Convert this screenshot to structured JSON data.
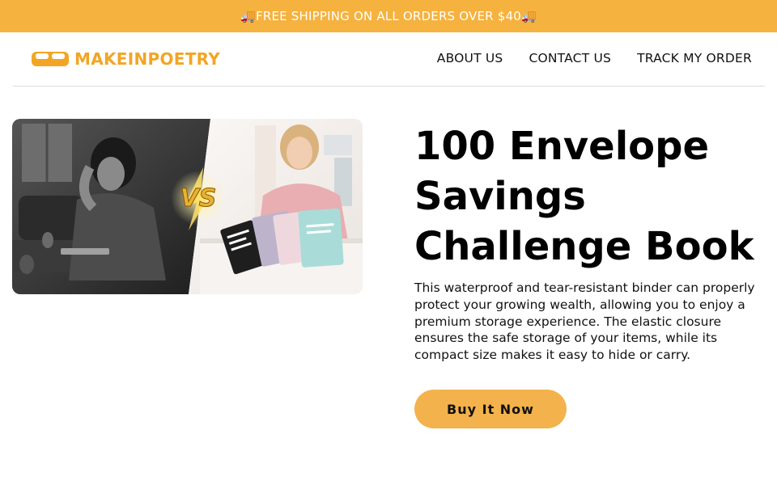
{
  "announcement": {
    "text": "🚚FREE SHIPPING ON ALL ORDERS OVER $40🚚"
  },
  "header": {
    "logo_text": "MAKEINPOETRY",
    "logo_icon": "sofa-icon",
    "nav": [
      {
        "label": "ABOUT US"
      },
      {
        "label": "CONTACT US"
      },
      {
        "label": "TRACK MY ORDER"
      }
    ]
  },
  "hero": {
    "image_badge": "VS",
    "title": "100 Envelope Savings Challenge Book",
    "description": "This waterproof and tear-resistant binder can properly protect your growing wealth, allowing you to enjoy a premium storage experience. The elastic closure ensures the safe storage of your items, while its compact size makes it easy to hide or carry.",
    "cta_label": "Buy It Now"
  },
  "colors": {
    "accent": "#f6b23e",
    "logo": "#f2a524",
    "button": "#f3b24b"
  }
}
